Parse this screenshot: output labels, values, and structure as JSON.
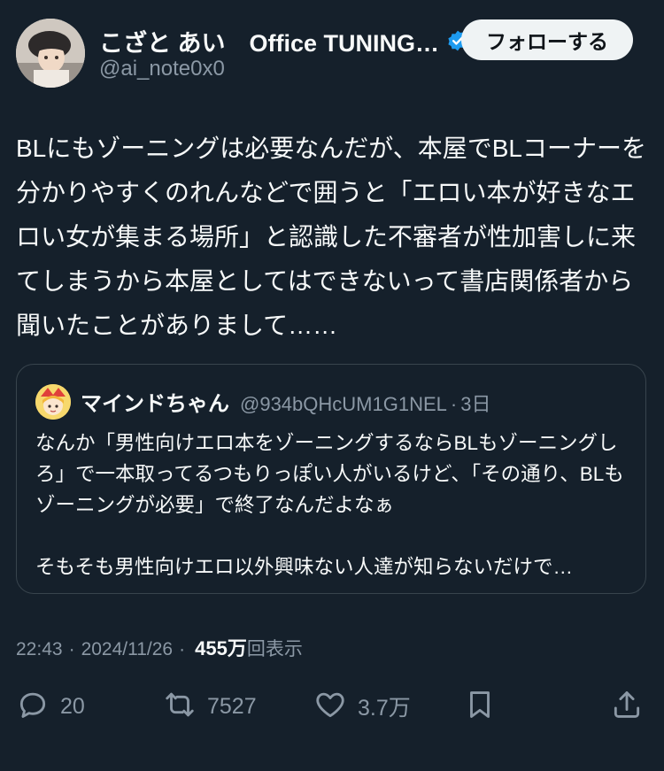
{
  "author": {
    "display_name": "こざと あい　Office TUNING…",
    "handle": "@ai_note0x0",
    "verified": true
  },
  "follow_button": {
    "label": "フォローする"
  },
  "tweet": {
    "text": "BLにもゾーニングは必要なんだが、本屋でBLコーナーを分かりやすくのれんなどで囲うと「エロい本が好きなエロい女が集まる場所」と認識した不審者が性加害しに来てしまうから本屋としてはできないって書店関係者から聞いたことがありまして……"
  },
  "quoted_tweet": {
    "display_name": "マインドちゃん",
    "handle": "@934bQHcUM1G1NEL",
    "separator": "·",
    "time": "3日",
    "text": "なんか「男性向けエロ本をゾーニングするならBLもゾーニングしろ」で一本取ってるつもりっぽい人がいるけど、「その通り、BLもゾーニングが必要」で終了なんだよなぁ\n\nそもそも男性向けエロ以外興味ない人達が知らないだけで…"
  },
  "meta": {
    "time": "22:43",
    "separator": "·",
    "date": "2024/11/26",
    "views_count": "455万",
    "views_label": "回表示"
  },
  "actions": {
    "reply_count": "20",
    "retweet_count": "7527",
    "like_count": "3.7万"
  },
  "icons": {
    "verified": "verified-badge-icon",
    "reply": "reply-icon",
    "retweet": "retweet-icon",
    "like": "heart-icon",
    "bookmark": "bookmark-icon",
    "share": "share-icon"
  },
  "colors": {
    "background": "#15202b",
    "text_primary": "#f7f9f9",
    "text_secondary": "#8b98a5",
    "border": "#38444d",
    "verified_blue": "#1d9bf0",
    "follow_button_bg": "#eff3f4"
  }
}
